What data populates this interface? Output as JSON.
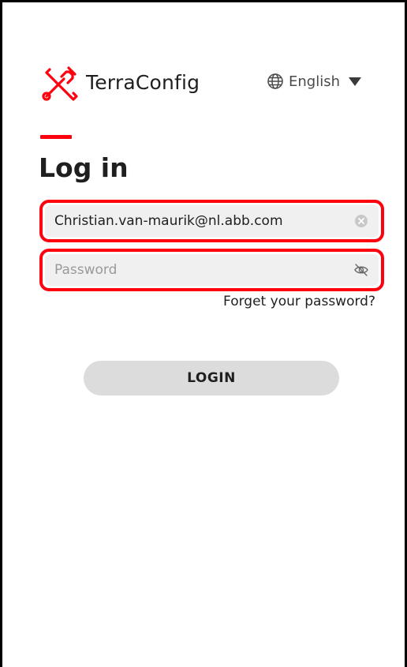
{
  "brand": {
    "name": "TerraConfig",
    "icon": "tools-icon"
  },
  "language": {
    "label": "English",
    "icon": "globe-icon"
  },
  "page": {
    "title": "Log in"
  },
  "email": {
    "value": "Christian.van-maurik@nl.abb.com"
  },
  "password": {
    "placeholder": "Password"
  },
  "links": {
    "forgot_password": "Forget your password?"
  },
  "actions": {
    "login_label": "LOGIN"
  },
  "colors": {
    "accent": "#ff000f",
    "field_bg": "#f0f0f0",
    "button_bg": "#dcdcdc"
  }
}
